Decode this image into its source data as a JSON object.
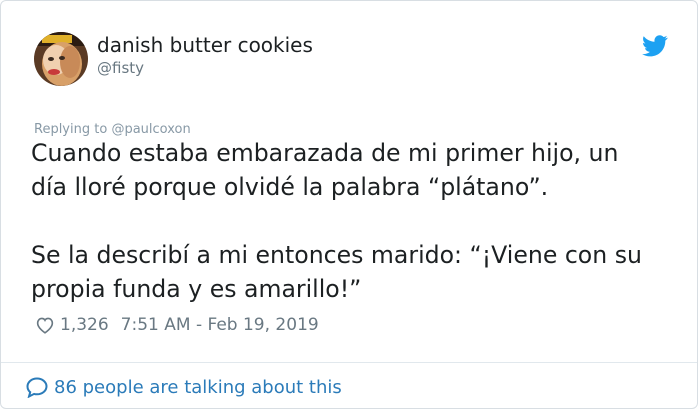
{
  "tweet": {
    "author_name": "danish butter cookies",
    "author_handle": "@fisty",
    "replying_prefix": "Replying to ",
    "replying_to": "@paulcoxon",
    "text": "Cuando estaba embarazada de mi primer hijo, un\ndía lloré porque olvidé la palabra “plátano”.\n\nSe la describí a mi entonces marido: “¡Viene con su\npropia funda y es amarillo!”",
    "like_count": "1,326",
    "timestamp": "7:51 AM - Feb 19, 2019"
  },
  "footer": {
    "talking_text": "86 people are talking about this"
  },
  "colors": {
    "twitter_blue": "#1da1f2",
    "link_blue": "#2b7bb9",
    "text_dark": "#1c2022",
    "text_muted": "#697882",
    "border": "#d8dee3"
  },
  "icons": {
    "brand": "twitter-bird-icon",
    "like": "heart-icon",
    "conversation": "speech-bubble-icon"
  }
}
